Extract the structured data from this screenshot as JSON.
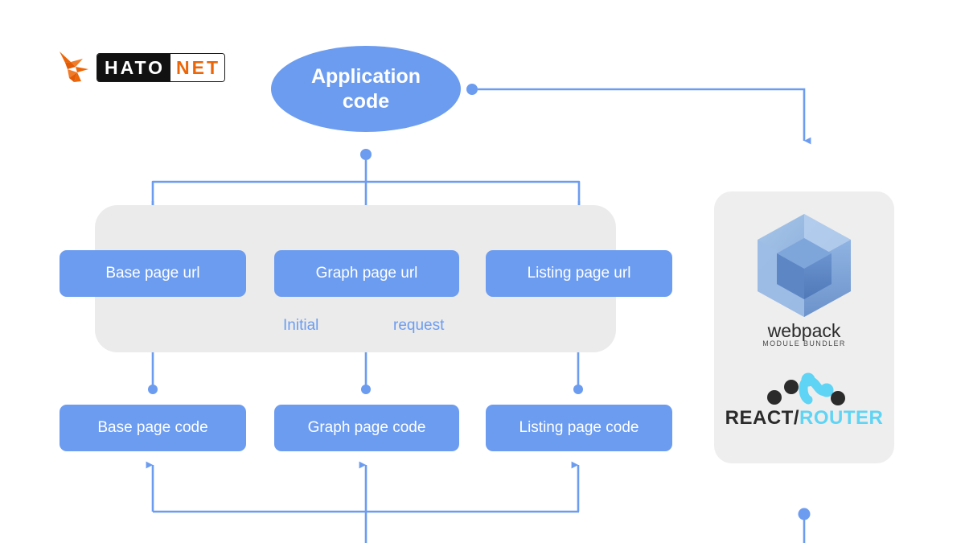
{
  "brand": {
    "logo_name": "hatonet-logo",
    "word_primary": "HATO",
    "word_secondary": "NET",
    "color_dark": "#111111",
    "color_accent": "#ec6608"
  },
  "theme": {
    "accent_blue": "#6c9cf0",
    "panel_gray": "#ebebeb",
    "tools_panel_gray": "#eeeeee",
    "text_on_accent": "#ffffff",
    "react_router_cyan": "#5fd4f4",
    "webpack_cube_blue": "#8aafdd"
  },
  "diagram": {
    "root_node": {
      "label": "Application\ncode",
      "line1": "Application",
      "line2": "code"
    },
    "url_row": [
      {
        "label": "Base page url"
      },
      {
        "label": "Graph page url"
      },
      {
        "label": "Listing page url"
      }
    ],
    "code_row": [
      {
        "label": "Base page code"
      },
      {
        "label": "Graph page code"
      },
      {
        "label": "Listing page code"
      }
    ],
    "flow_labels": {
      "initial": "Initial",
      "request": "request"
    }
  },
  "tools": {
    "webpack": {
      "name": "webpack",
      "tagline": "MODULE BUNDLER"
    },
    "react_router": {
      "word_dark": "REACT/",
      "word_cyan": "ROUTER"
    }
  }
}
